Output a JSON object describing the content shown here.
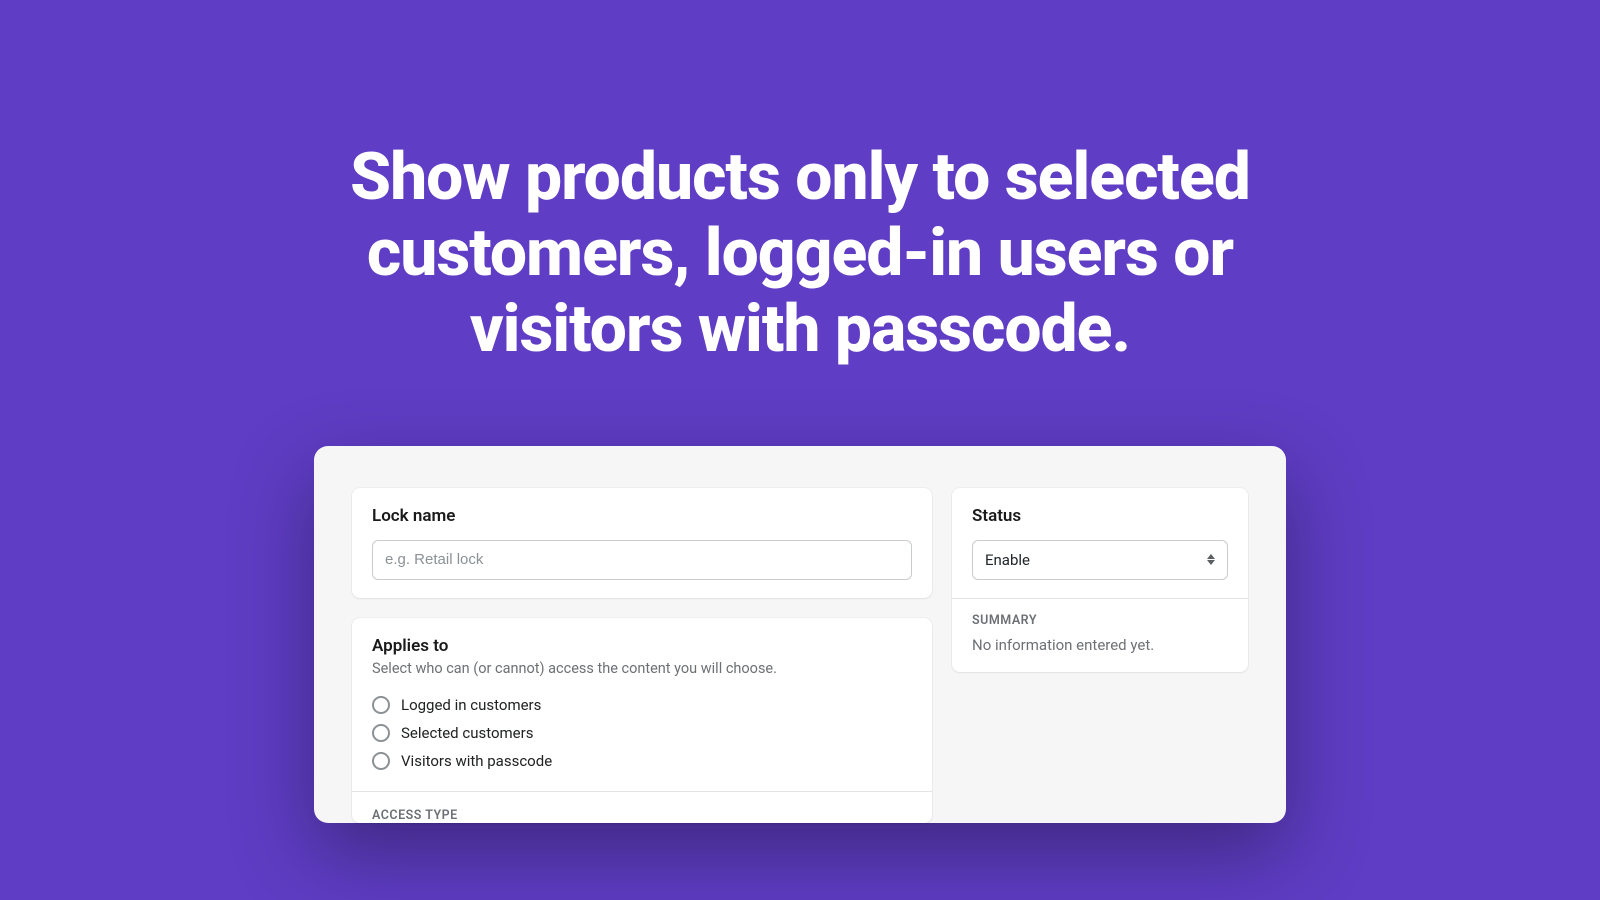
{
  "hero": {
    "line1": "Show products only to selected",
    "line2": "customers, logged-in users or",
    "line3": "visitors with passcode."
  },
  "lock_name": {
    "title": "Lock name",
    "placeholder": "e.g. Retail lock",
    "value": ""
  },
  "applies_to": {
    "title": "Applies to",
    "helper": "Select who can (or cannot) access the content you will choose.",
    "options": [
      {
        "label": "Logged in customers"
      },
      {
        "label": "Selected customers"
      },
      {
        "label": "Visitors with passcode"
      }
    ],
    "access_type_label": "ACCESS TYPE"
  },
  "status": {
    "title": "Status",
    "selected": "Enable"
  },
  "summary": {
    "label": "SUMMARY",
    "text": "No information entered yet."
  }
}
